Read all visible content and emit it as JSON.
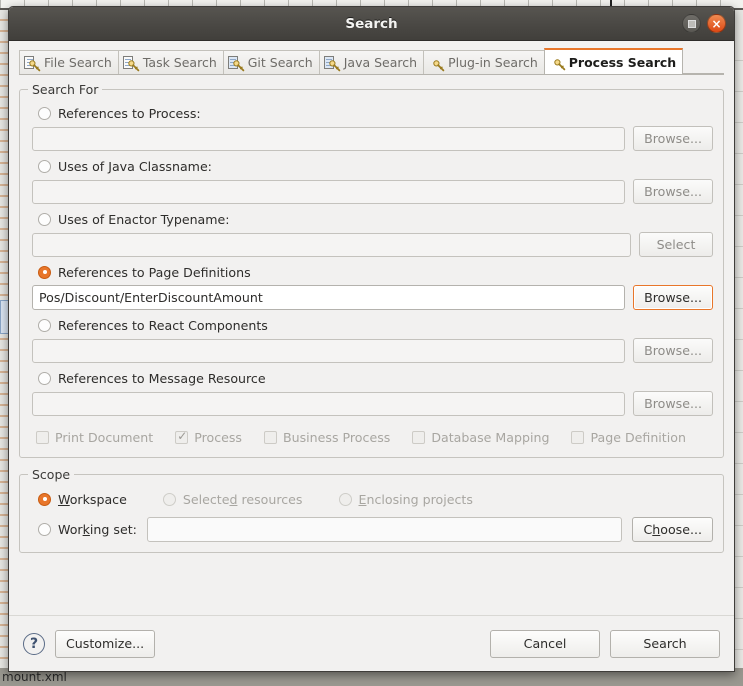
{
  "background": {
    "status_text": "mount.xml"
  },
  "window": {
    "title": "Search",
    "maximize_label": "Maximize",
    "close_label": "Close"
  },
  "tabs": [
    {
      "label": "File Search",
      "icon": "file-search-icon",
      "active": false
    },
    {
      "label": "Task Search",
      "icon": "task-search-icon",
      "active": false
    },
    {
      "label": "Git Search",
      "icon": "git-search-icon",
      "active": false
    },
    {
      "label": "Java Search",
      "icon": "java-search-icon",
      "active": false
    },
    {
      "label": "Plug-in Search",
      "icon": "plugin-search-icon",
      "active": false
    },
    {
      "label": "Process Search",
      "icon": "process-search-icon",
      "active": true
    }
  ],
  "search_for": {
    "legend": "Search For",
    "options": [
      {
        "label": "References to Process:",
        "selected": false,
        "value": "",
        "button": "Browse...",
        "button_enabled": false,
        "button_focus": false
      },
      {
        "label": "Uses of Java Classname:",
        "selected": false,
        "value": "",
        "button": "Browse...",
        "button_enabled": false,
        "button_focus": false
      },
      {
        "label": "Uses of Enactor Typename:",
        "selected": false,
        "value": "",
        "button": "Select",
        "button_enabled": false,
        "button_focus": false
      },
      {
        "label": "References to Page Definitions",
        "selected": true,
        "value": "Pos/Discount/EnterDiscountAmount",
        "button": "Browse...",
        "button_enabled": true,
        "button_focus": true
      },
      {
        "label": "References to React Components",
        "selected": false,
        "value": "",
        "button": "Browse...",
        "button_enabled": false,
        "button_focus": false
      },
      {
        "label": "References to Message Resource",
        "selected": false,
        "value": "",
        "button": "Browse...",
        "button_enabled": false,
        "button_focus": false
      }
    ],
    "filters": [
      {
        "label": "Print Document",
        "checked": false,
        "enabled": false
      },
      {
        "label": "Process",
        "checked": true,
        "enabled": false
      },
      {
        "label": "Business Process",
        "checked": false,
        "enabled": false
      },
      {
        "label": "Database Mapping",
        "checked": false,
        "enabled": false
      },
      {
        "label": "Page Definition",
        "checked": false,
        "enabled": false
      }
    ]
  },
  "scope": {
    "legend": "Scope",
    "workspace": {
      "label_pre": "",
      "mnemonic": "W",
      "label_post": "orkspace",
      "selected": true,
      "enabled": true
    },
    "selected_resources": {
      "label_pre": "Selecte",
      "mnemonic": "d",
      "label_post": " resources",
      "selected": false,
      "enabled": false
    },
    "enclosing_projects": {
      "label_pre": "",
      "mnemonic": "E",
      "label_post": "nclosing projects",
      "selected": false,
      "enabled": false
    },
    "working_set": {
      "label_pre": "Wor",
      "mnemonic": "k",
      "label_post": "ing set:",
      "selected": false,
      "enabled": true,
      "value": ""
    },
    "choose_button": {
      "label_pre": "C",
      "mnemonic": "h",
      "label_post": "oose...",
      "enabled": true
    }
  },
  "footer": {
    "help_glyph": "?",
    "customize_label": "Customize...",
    "cancel_label": "Cancel",
    "search_label": "Search"
  },
  "colors": {
    "accent_orange": "#e8762a",
    "titlebar": "#4a4844",
    "dialog_bg": "#f2f1f0",
    "close_button": "#dd4814"
  }
}
